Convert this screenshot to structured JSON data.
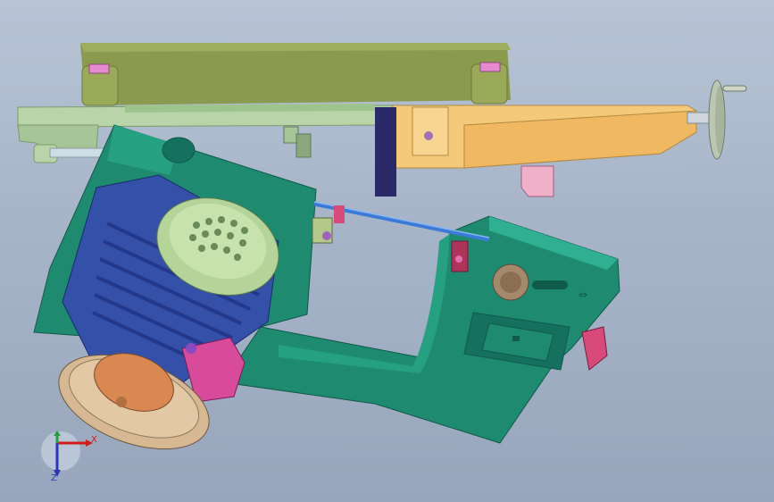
{
  "viewport": {
    "background_top": "#b8c4d6",
    "background_bottom": "#98a6bd"
  },
  "model": {
    "colors": {
      "table_top": "#8a9a4e",
      "cross_slide": "#f5c97a",
      "base_rail": "#b8d4a8",
      "frame": "#1e8a70",
      "motor_body": "#3550a8",
      "motor_fan_cover": "#b4d49a",
      "pulley": "#d8b892",
      "junction_box": "#d84a9a",
      "guide_rod": "#3a7ad8",
      "handwheel": "#a48a6a"
    },
    "parts": [
      "table-top",
      "cross-slide",
      "base-rail",
      "saw-frame",
      "motor",
      "motor-fan-cover",
      "junction-box",
      "pulley",
      "guide-rod",
      "blade-guide-left",
      "blade-guide-right",
      "tension-knob",
      "handwheel",
      "clamp-plate",
      "limit-switch"
    ]
  },
  "triad": {
    "x_label": "X",
    "z_label": "Z",
    "x_color": "#d21b1b",
    "y_color": "#26a03a",
    "z_color": "#2a38b8"
  }
}
